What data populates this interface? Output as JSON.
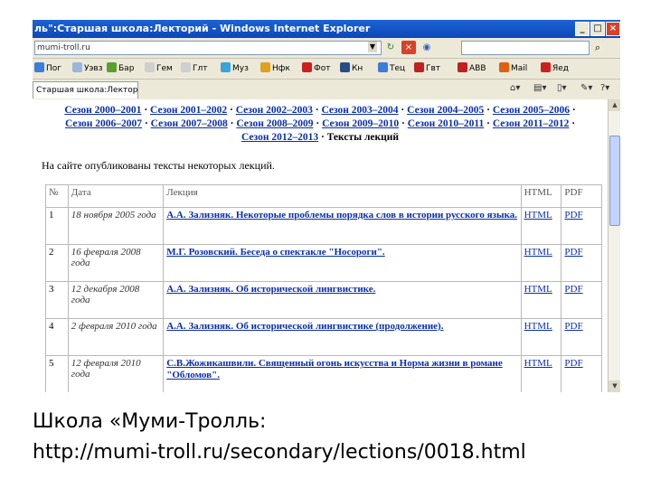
{
  "window": {
    "title": "ль\":Старшая школа:Лекторий - Windows Internet Explorer",
    "minimize_icon": "minimize-icon",
    "maximize_icon": "maximize-icon",
    "close_icon": "close-icon"
  },
  "address": {
    "url": "mumi-troll.ru",
    "search_icon": "search-icon"
  },
  "favorites": [
    {
      "label": "Пог",
      "color": "#3b7dd8"
    },
    {
      "label": "Уэвз",
      "color": "#9bb5e0"
    },
    {
      "label": "Бар",
      "color": "#5aa02c"
    },
    {
      "label": "Гем",
      "color": "#cfcfcf"
    },
    {
      "label": "Глт",
      "color": "#cfcfcf"
    },
    {
      "label": "Муз",
      "color": "#3aa3d8"
    },
    {
      "label": "Нфк",
      "color": "#e0a020"
    },
    {
      "label": "Фот",
      "color": "#cc2020"
    },
    {
      "label": "Кн",
      "color": "#2a4a8a"
    },
    {
      "label": "Тец",
      "color": "#3b7dd8"
    },
    {
      "label": "Гвт",
      "color": "#c02020"
    },
    {
      "label": "АВВ",
      "color": "#c02020"
    },
    {
      "label": "Mail",
      "color": "#e06010"
    },
    {
      "label": "Яед",
      "color": "#cc2020"
    }
  ],
  "tab": {
    "label": "Старшая школа:Лекторий"
  },
  "seasons": {
    "line1": [
      "Сезон 2000–2001",
      "Сезон 2001–2002",
      "Сезон 2002–2003",
      "Сезон 2003–2004",
      "Сезон 2004–2005",
      "Сезон 2005–2006"
    ],
    "line2": [
      "Сезон 2006–2007",
      "Сезон 2007–2008",
      "Сезон 2008–2009",
      "Сезон 2009–2010",
      "Сезон 2010–2011",
      "Сезон 2011–2012"
    ],
    "line3_link": "Сезон 2012–2013",
    "line3_current": "Тексты лекций",
    "separator": " · "
  },
  "intro": "На сайте опубликованы тексты некоторых лекций.",
  "table": {
    "headers": [
      "№",
      "Дата",
      "Лекция",
      "HTML",
      "PDF"
    ],
    "rows": [
      {
        "num": "1",
        "date": "18 ноября 2005 года",
        "lecture": "А.А. Зализняк. Некоторые проблемы порядка слов в истории русского языка.",
        "html": "HTML",
        "pdf": "PDF"
      },
      {
        "num": "2",
        "date": "16 февраля 2008 года",
        "lecture": "М.Г. Розовский. Беседа о спектакле \"Носороги\".",
        "html": "HTML",
        "pdf": "PDF"
      },
      {
        "num": "3",
        "date": "12 декабря 2008 года",
        "lecture": "А.А. Зализняк. Об исторической лингвистике.",
        "html": "HTML",
        "pdf": "PDF"
      },
      {
        "num": "4",
        "date": "2 февраля 2010 года",
        "lecture": "А.А. Зализняк. Об исторической лингвистике (продолжение).",
        "html": "HTML",
        "pdf": "PDF"
      },
      {
        "num": "5",
        "date": "12 февраля 2010 года",
        "lecture": "С.В.Жожикашвили. Священный огонь искусства и Норма жизни в романе \"Обломов\".",
        "html": "HTML",
        "pdf": "PDF"
      }
    ]
  },
  "caption": {
    "line1": "Школа «Муми-Тролль:",
    "line2": "http://mumi-troll.ru/secondary/lections/0018.html"
  }
}
